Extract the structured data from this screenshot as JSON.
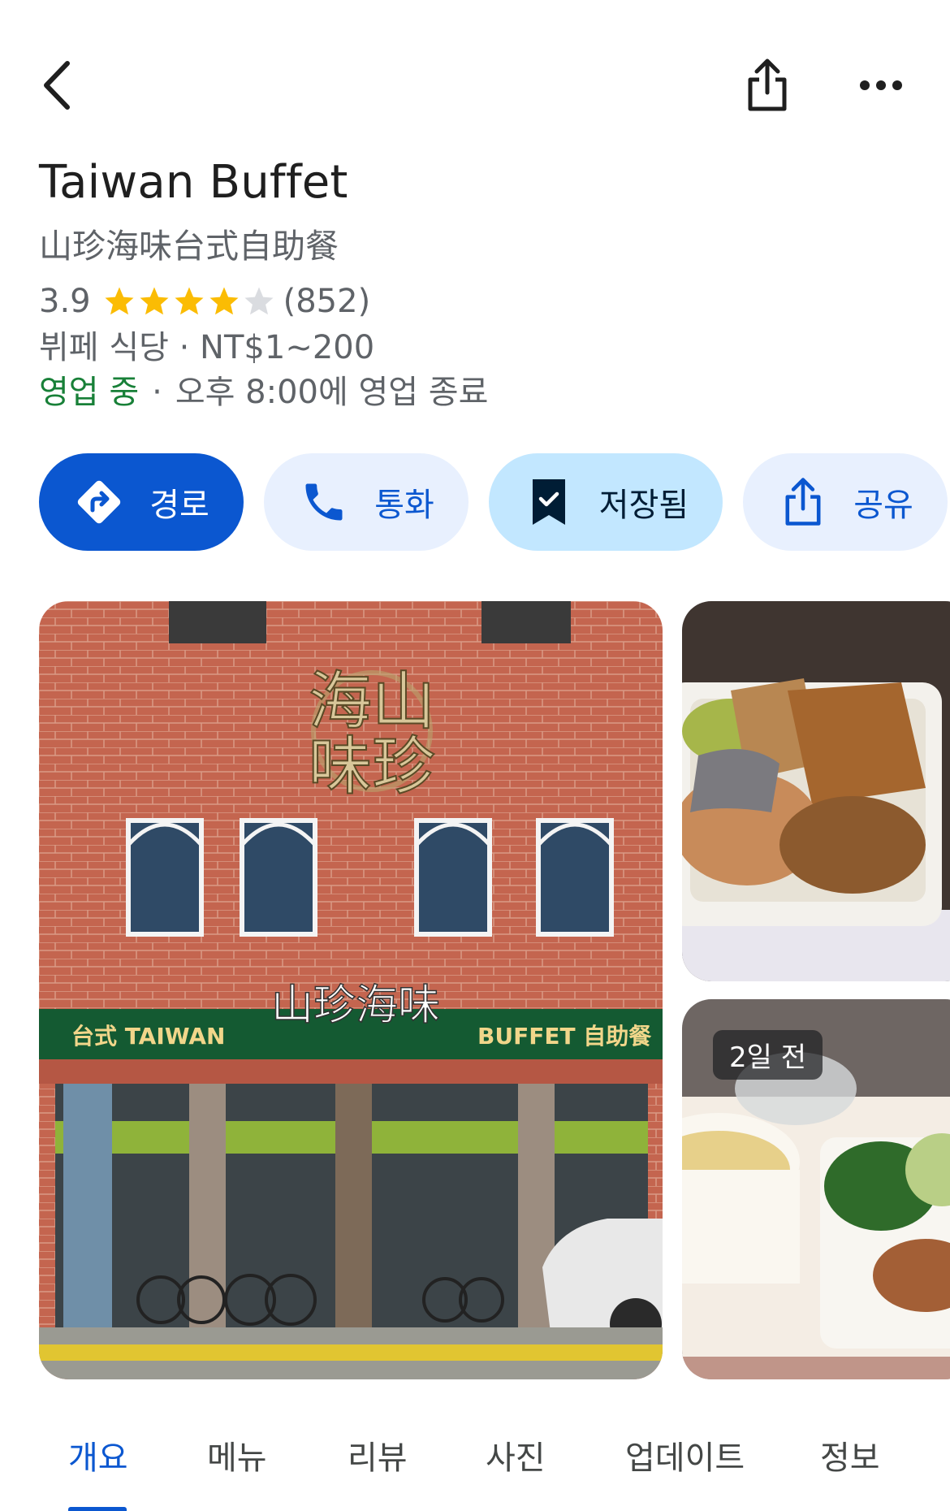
{
  "header": {
    "back_icon": "chevron-left-icon",
    "share_icon": "share-icon",
    "more_icon": "more-horiz-icon"
  },
  "place": {
    "name": "Taiwan Buffet",
    "native_name": "山珍海味台式自助餐",
    "rating": "3.9",
    "rating_value": 3.9,
    "review_count": "(852)",
    "category_price": "뷔페 식당 · NT$1~200",
    "open_status": "영업 중",
    "separator": "·",
    "hours_note": "오후 8:00에 영업 종료"
  },
  "actions": {
    "route": {
      "label": "경로",
      "icon": "directions-icon"
    },
    "call": {
      "label": "통화",
      "icon": "phone-icon"
    },
    "saved": {
      "label": "저장됨",
      "icon": "bookmark-check-icon"
    },
    "share": {
      "label": "공유",
      "icon": "share-icon"
    }
  },
  "photos": {
    "main": {
      "signs": [
        "山珍海味",
        "台式 TAIWAN",
        "山珍海味",
        "BUFFET 自助餐"
      ]
    },
    "side2_badge": "2일 전"
  },
  "tabs": [
    "개요",
    "메뉴",
    "리뷰",
    "사진",
    "업데이트",
    "정보"
  ],
  "active_tab": "개요",
  "colors": {
    "accent": "#0b57d0",
    "open": "#188038",
    "star": "#fbbc04",
    "star_empty": "#dadce0"
  }
}
